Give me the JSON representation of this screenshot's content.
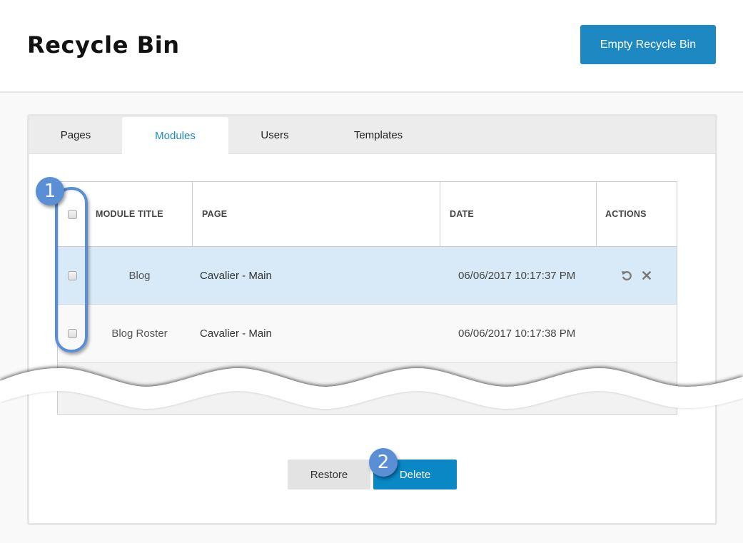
{
  "header": {
    "title": "Recycle Bin",
    "empty_button_label": "Empty Recycle Bin"
  },
  "tabs": [
    {
      "label": "Pages",
      "active": false
    },
    {
      "label": "Modules",
      "active": true
    },
    {
      "label": "Users",
      "active": false
    },
    {
      "label": "Templates",
      "active": false
    }
  ],
  "table": {
    "columns": [
      "MODULE TITLE",
      "PAGE",
      "DATE",
      "ACTIONS"
    ],
    "rows": [
      {
        "title": "Blog",
        "page": "Cavalier - Main",
        "date": "06/06/2017 10:17:37 PM",
        "selected": false,
        "highlighted": true,
        "actions": [
          "restore-icon",
          "delete-icon"
        ]
      },
      {
        "title": "Blog Roster",
        "page": "Cavalier - Main",
        "date": "06/06/2017 10:17:38 PM",
        "selected": false,
        "highlighted": false,
        "actions": []
      }
    ]
  },
  "footer": {
    "restore_label": "Restore",
    "delete_label": "Delete"
  },
  "annotations": {
    "badge_1": "1",
    "badge_2": "2",
    "accent_color": "#5a8fd6"
  },
  "colors": {
    "primary": "#1e88c3",
    "delete_button": "#0a87c5",
    "active_tab_text": "#1e88c3",
    "highlight_row": "#d8eaf7"
  }
}
